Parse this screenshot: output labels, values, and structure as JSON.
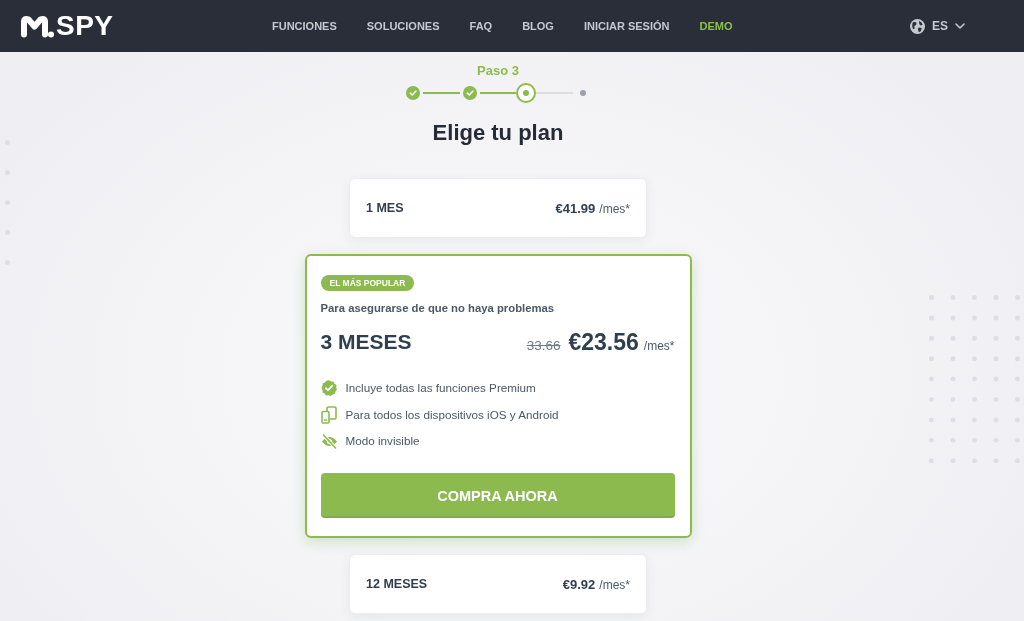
{
  "header": {
    "logo": "SPY",
    "nav": [
      {
        "label": "FUNCIONES",
        "accent": false
      },
      {
        "label": "SOLUCIONES",
        "accent": false
      },
      {
        "label": "FAQ",
        "accent": false
      },
      {
        "label": "BLOG",
        "accent": false
      },
      {
        "label": "INICIAR SESIÓN",
        "accent": false
      },
      {
        "label": "DEMO",
        "accent": true
      }
    ],
    "language": "ES"
  },
  "stepper": {
    "label": "Paso 3",
    "steps": [
      {
        "done": true,
        "current": false
      },
      {
        "done": true,
        "current": false
      },
      {
        "done": false,
        "current": true
      },
      {
        "done": false,
        "current": false
      }
    ]
  },
  "title": "Elige tu plan",
  "plans": [
    {
      "name": "1 MES",
      "price": "€41.99",
      "unit": "/mes*",
      "selected": false
    },
    {
      "badge": "EL MÁS POPULAR",
      "subtitle": "Para asegurarse de que no haya problemas",
      "name": "3 MESES",
      "old_price": "33.66",
      "price": "€23.56",
      "unit": "/mes*",
      "features": [
        {
          "kind": "check",
          "text": "Incluye todas las funciones Premium"
        },
        {
          "kind": "devices",
          "text": "Para todos los dispositivos iOS y Android"
        },
        {
          "kind": "hidden",
          "text": "Modo invisible"
        }
      ],
      "button": "COMPRA AHORA",
      "selected": true
    },
    {
      "name": "12 MESES",
      "price": "€9.92",
      "unit": "/mes*",
      "selected": false
    }
  ]
}
